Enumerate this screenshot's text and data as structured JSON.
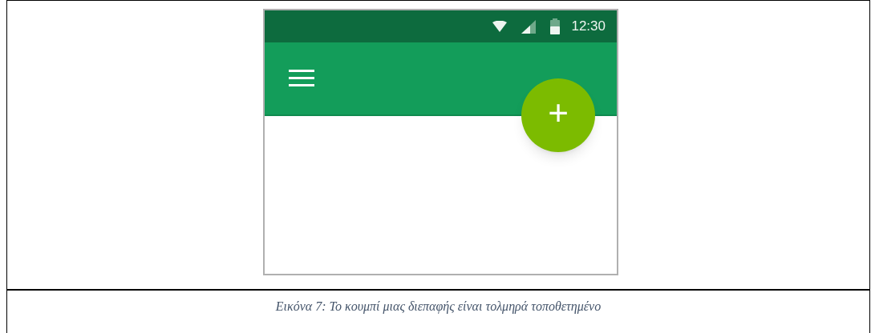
{
  "phone": {
    "status_bar": {
      "time": "12:30"
    },
    "fab": {
      "label": "+"
    }
  },
  "caption": "Εικόνα 7: Το κουμπί μιας διεπαφής είναι τολμηρά τοποθετημένο"
}
